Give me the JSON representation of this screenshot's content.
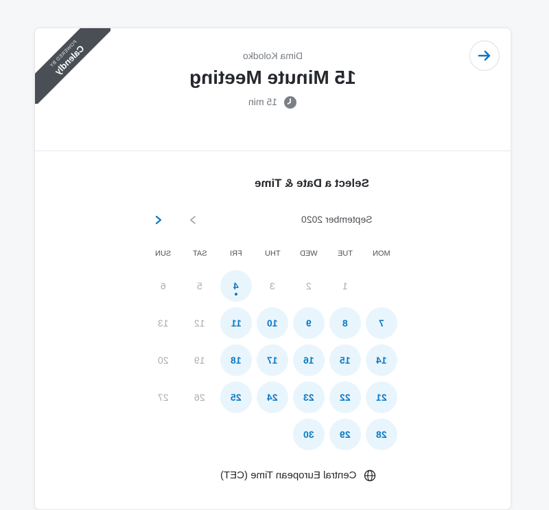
{
  "ribbon": {
    "small_text": "POWERED BY",
    "brand": "Calendly"
  },
  "header": {
    "organizer": "Dima Kolodko",
    "title": "15 Minute Meeting",
    "duration": "15 min"
  },
  "picker": {
    "section_title": "Select a Date & Time",
    "month": "September 2020",
    "weekdays": [
      "MON",
      "TUE",
      "WED",
      "THU",
      "FRI",
      "SAT",
      "SUN"
    ],
    "weeks": [
      [
        {
          "d": "",
          "a": false
        },
        {
          "d": "1",
          "a": false
        },
        {
          "d": "2",
          "a": false
        },
        {
          "d": "3",
          "a": false
        },
        {
          "d": "4",
          "a": true,
          "today": true
        },
        {
          "d": "5",
          "a": false
        },
        {
          "d": "6",
          "a": false
        }
      ],
      [
        {
          "d": "7",
          "a": true
        },
        {
          "d": "8",
          "a": true
        },
        {
          "d": "9",
          "a": true
        },
        {
          "d": "10",
          "a": true
        },
        {
          "d": "11",
          "a": true
        },
        {
          "d": "12",
          "a": false
        },
        {
          "d": "13",
          "a": false
        }
      ],
      [
        {
          "d": "14",
          "a": true
        },
        {
          "d": "15",
          "a": true
        },
        {
          "d": "16",
          "a": true
        },
        {
          "d": "17",
          "a": true
        },
        {
          "d": "18",
          "a": true
        },
        {
          "d": "19",
          "a": false
        },
        {
          "d": "20",
          "a": false
        }
      ],
      [
        {
          "d": "21",
          "a": true
        },
        {
          "d": "22",
          "a": true
        },
        {
          "d": "23",
          "a": true
        },
        {
          "d": "24",
          "a": true
        },
        {
          "d": "25",
          "a": true
        },
        {
          "d": "26",
          "a": false
        },
        {
          "d": "27",
          "a": false
        }
      ],
      [
        {
          "d": "28",
          "a": true
        },
        {
          "d": "29",
          "a": true
        },
        {
          "d": "30",
          "a": true
        },
        {
          "d": "",
          "a": false
        },
        {
          "d": "",
          "a": false
        },
        {
          "d": "",
          "a": false
        },
        {
          "d": "",
          "a": false
        }
      ]
    ]
  },
  "timezone": {
    "label": "Central European Time (CET)",
    "icon": "globe-icon"
  },
  "colors": {
    "accent": "#0b78c2",
    "available_bg": "#e9f5fd",
    "ribbon": "#4a4f55"
  }
}
